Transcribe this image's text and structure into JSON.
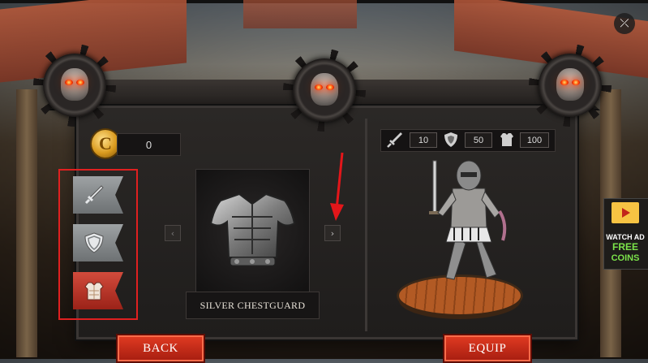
{
  "coins": {
    "amount": "0",
    "icon": "gold-coin-icon"
  },
  "categories": [
    {
      "name": "weapon",
      "icon": "sword-icon",
      "active": false
    },
    {
      "name": "shield",
      "icon": "shield-icon",
      "active": false
    },
    {
      "name": "armor",
      "icon": "chestplate-icon",
      "active": true
    }
  ],
  "item": {
    "name": "SILVER CHESTGUARD"
  },
  "stats": {
    "attack": "10",
    "defense": "50",
    "armor": "100"
  },
  "ad": {
    "line1": "WATCH AD",
    "line2": "FREE",
    "line3": "COINS"
  },
  "buttons": {
    "back": "BACK",
    "equip": "EQUIP"
  },
  "colors": {
    "accent_red": "#d62a16",
    "gold": "#d99a1e",
    "highlight": "#e02020"
  }
}
